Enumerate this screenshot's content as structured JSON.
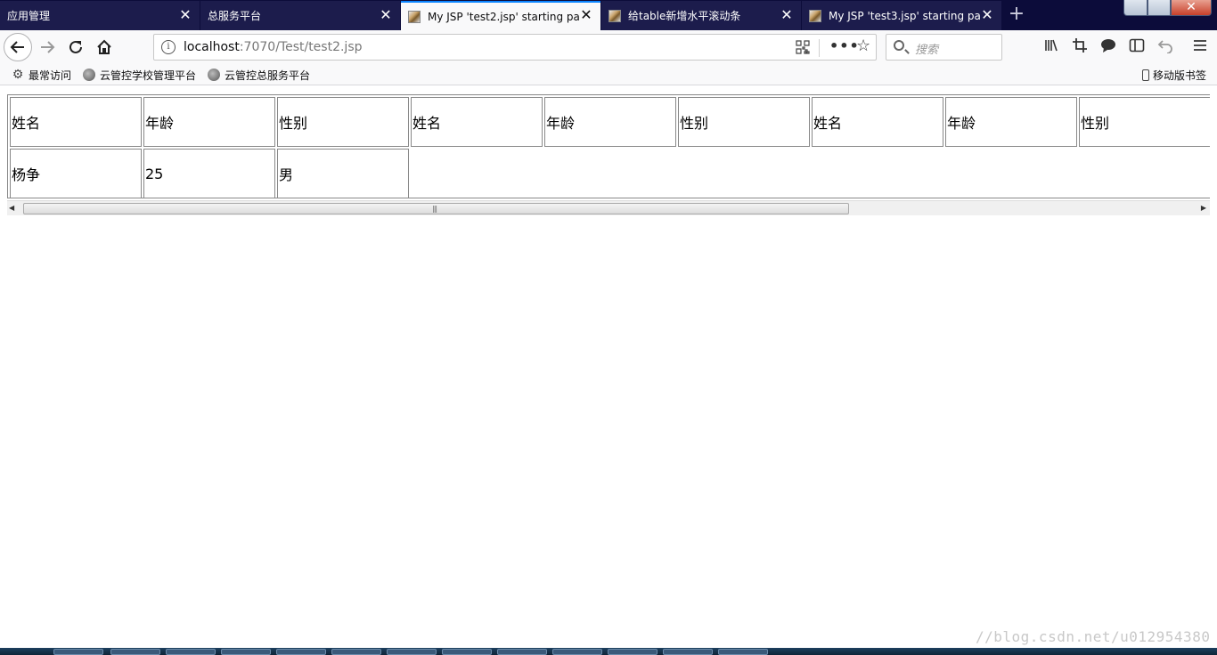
{
  "tabs": [
    {
      "label": "应用管理",
      "favicon": false,
      "active": false
    },
    {
      "label": "总服务平台",
      "favicon": false,
      "active": false
    },
    {
      "label": "My JSP 'test2.jsp' starting pa",
      "favicon": true,
      "active": true
    },
    {
      "label": "给table新增水平滚动条",
      "favicon": true,
      "active": false
    },
    {
      "label": "My JSP 'test3.jsp' starting pa",
      "favicon": true,
      "active": false
    }
  ],
  "tab_close_glyph": "✕",
  "new_tab_glyph": "+",
  "window_close_glyph": "✕",
  "url": {
    "host": "localhost",
    "rest": ":7070/Test/test2.jsp"
  },
  "search": {
    "placeholder": "搜索"
  },
  "bookmarks": {
    "most_visited": "最常访问",
    "school_platform": "云管控学校管理平台",
    "main_platform": "云管控总服务平台",
    "mobile": "移动版书签"
  },
  "table": {
    "header": [
      "姓名",
      "年龄",
      "性别",
      "姓名",
      "年龄",
      "性别",
      "姓名",
      "年龄",
      "性别"
    ],
    "rows": [
      [
        "杨争",
        "25",
        "男"
      ]
    ]
  },
  "watermark": "//blog.csdn.net/u012954380",
  "colors": {
    "tabstrip": "#0c0c3a",
    "active_tab_accent": "#0a84ff",
    "toolbar": "#f9f9fa"
  }
}
